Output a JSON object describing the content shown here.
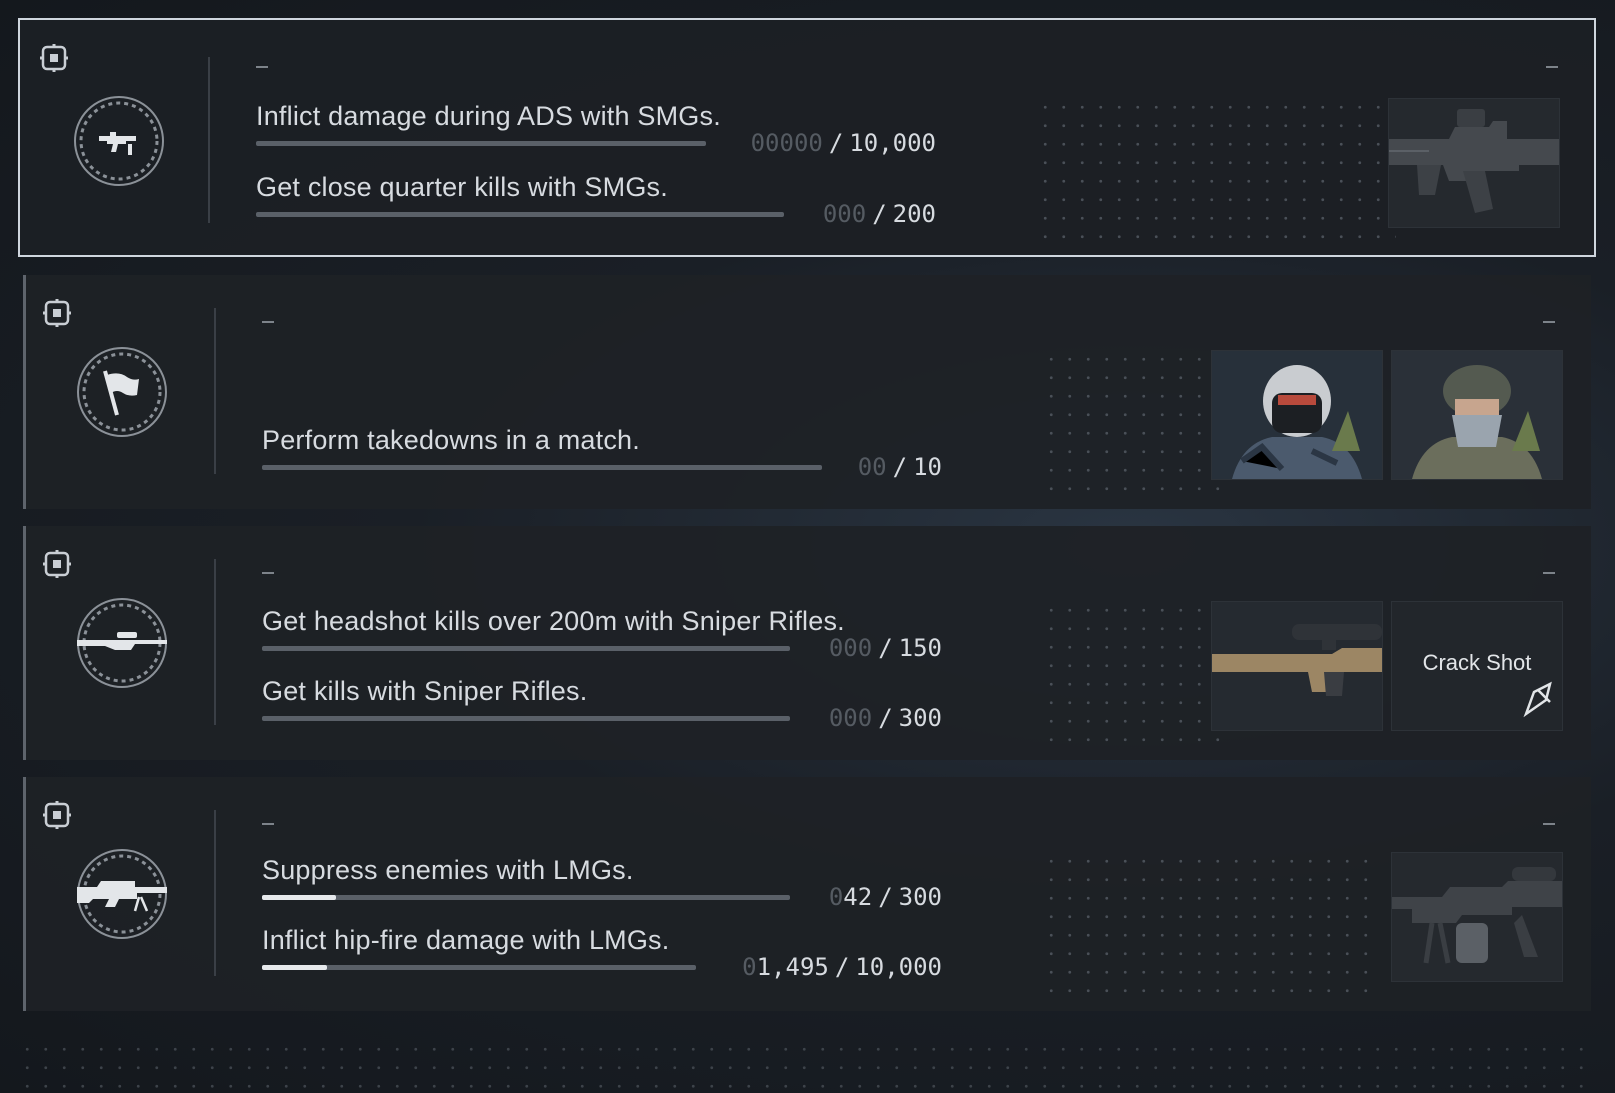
{
  "cards": [
    {
      "icon": "smg-icon",
      "objectives": [
        {
          "text": "Inflict damage during ADS with SMGs.",
          "pad": "00000",
          "value": "",
          "target": "10,000",
          "progress": 0
        },
        {
          "text": "Get close quarter kills with SMGs.",
          "pad": "000",
          "value": "",
          "target": "200",
          "progress": 0
        }
      ],
      "rewards": [
        "smg-weapon-image"
      ]
    },
    {
      "icon": "flag-icon",
      "objectives": [
        {
          "text": "Perform takedowns in a match.",
          "pad": "00",
          "value": "",
          "target": "10",
          "progress": 0
        }
      ],
      "rewards": [
        "operator-helmet-image",
        "operator-mask-image"
      ]
    },
    {
      "icon": "sniper-icon",
      "objectives": [
        {
          "text": "Get headshot kills over 200m with Sniper Rifles.",
          "pad": "000",
          "value": "",
          "target": "150",
          "progress": 0
        },
        {
          "text": "Get kills with Sniper Rifles.",
          "pad": "000",
          "value": "",
          "target": "300",
          "progress": 0
        }
      ],
      "rewards": [
        "sniper-rifle-image",
        "title-card"
      ],
      "reward_title": "Crack Shot"
    },
    {
      "icon": "lmg-icon",
      "objectives": [
        {
          "text": "Suppress enemies with LMGs.",
          "pad": "0",
          "value": "42",
          "target": "300",
          "progress": 0.14
        },
        {
          "text": "Inflict hip-fire damage with LMGs.",
          "pad": "0",
          "value": "1,495",
          "target": "10,000",
          "progress": 0.15
        }
      ],
      "rewards": [
        "lmg-weapon-image"
      ]
    }
  ],
  "separator": "/",
  "colors": {
    "accent": "#e6e9ec",
    "track": "#5a6068",
    "pad_digits": "#555b62",
    "selected_border": "#cfd6de"
  }
}
